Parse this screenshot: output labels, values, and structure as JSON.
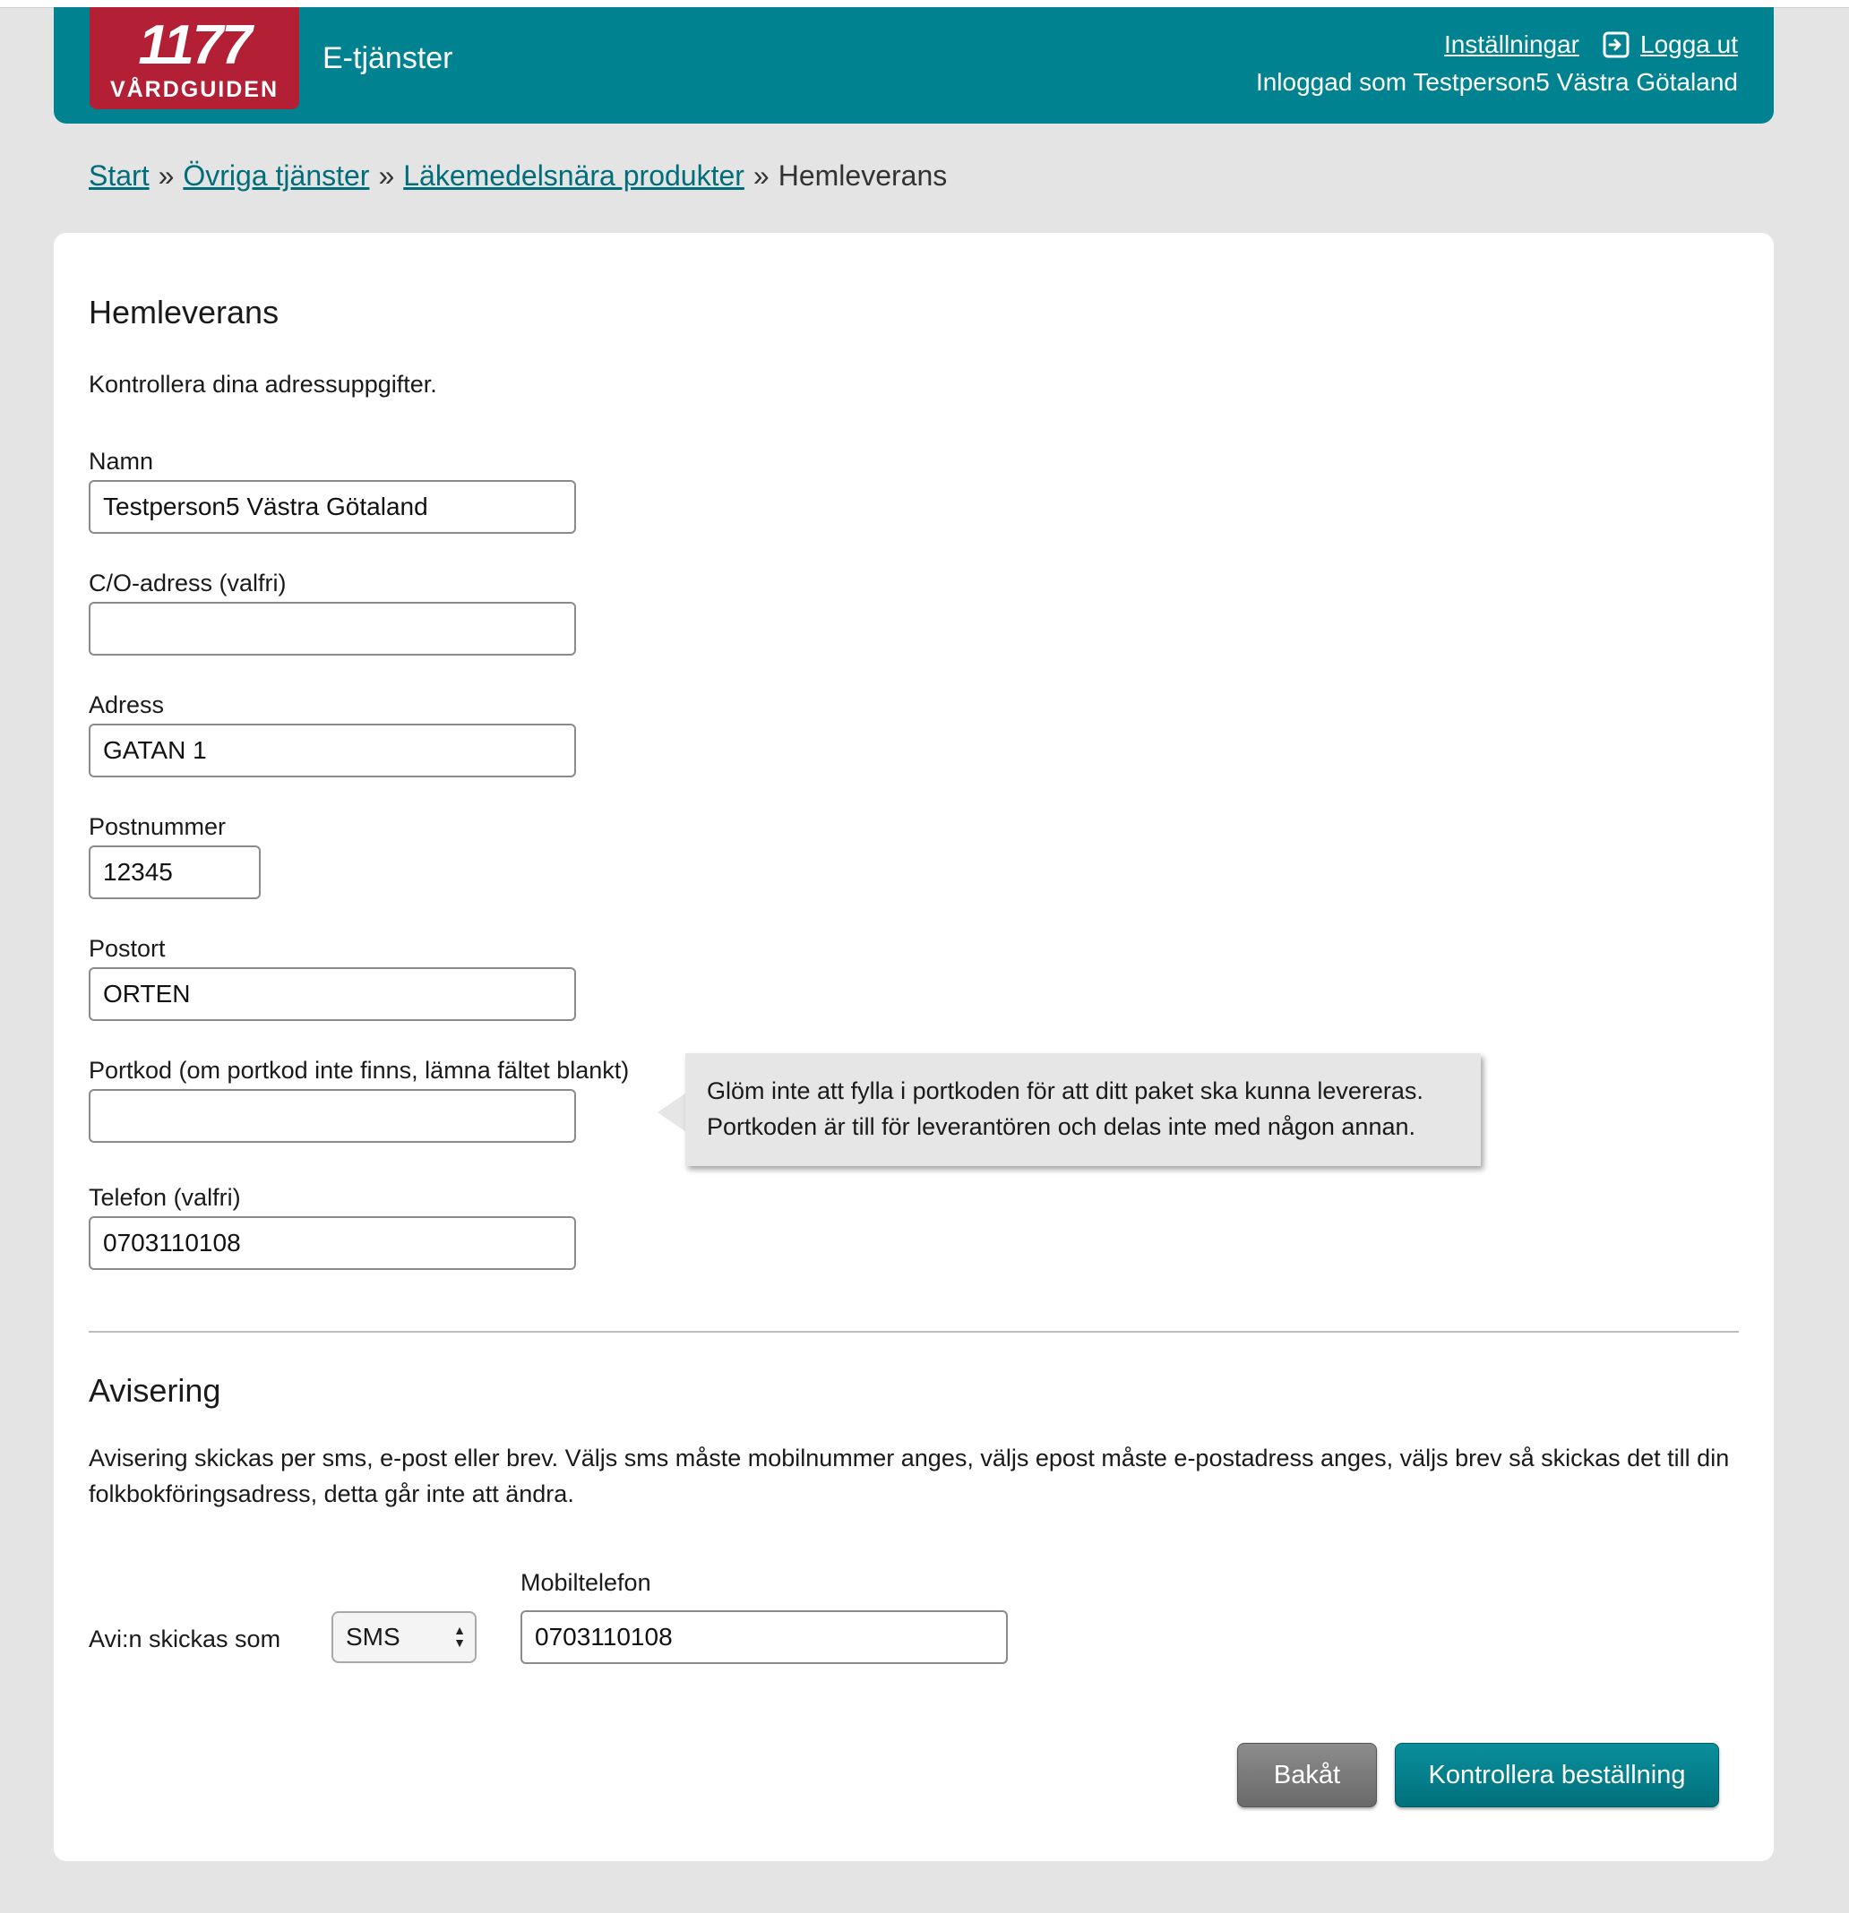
{
  "header": {
    "logo_number": "1177",
    "logo_text": "VÅRDGUIDEN",
    "service_title": "E-tjänster",
    "settings_link": "Inställningar",
    "logout_link": "Logga ut",
    "logged_in_as": "Inloggad som Testperson5 Västra Götaland"
  },
  "breadcrumb": {
    "items": [
      "Start",
      "Övriga tjänster",
      "Läkemedelsnära produkter"
    ],
    "current": "Hemleverans",
    "separator": "»"
  },
  "form": {
    "title": "Hemleverans",
    "intro": "Kontrollera dina adressuppgifter.",
    "fields": {
      "name": {
        "label": "Namn",
        "value": "Testperson5 Västra Götaland"
      },
      "co_address": {
        "label": "C/O-adress (valfri)",
        "value": ""
      },
      "address": {
        "label": "Adress",
        "value": "GATAN 1"
      },
      "postal_code": {
        "label": "Postnummer",
        "value": "12345"
      },
      "city": {
        "label": "Postort",
        "value": "ORTEN"
      },
      "door_code": {
        "label": "Portkod (om portkod inte finns, lämna fältet blankt)",
        "value": ""
      },
      "phone": {
        "label": "Telefon (valfri)",
        "value": "0703110108"
      }
    },
    "door_code_tooltip": {
      "line1": "Glöm inte att fylla i portkoden för att ditt paket ska kunna levereras.",
      "line2": "Portkoden är till för leverantören och delas inte med någon annan."
    }
  },
  "notification": {
    "title": "Avisering",
    "text": "Avisering skickas per sms, e-post eller brev. Väljs sms måste mobilnummer anges, väljs epost måste e-postadress anges, väljs brev så skickas det till din folkbokföringsadress, detta går inte att ändra.",
    "send_as_label": "Avi:n skickas som",
    "send_as_value": "SMS",
    "mobile_label": "Mobiltelefon",
    "mobile_value": "0703110108"
  },
  "buttons": {
    "back": "Bakåt",
    "check_order": "Kontrollera beställning"
  },
  "colors": {
    "header_teal": "#008290",
    "logo_red": "#b31f35",
    "link_teal": "#006d7a",
    "page_background": "#e4e4e4"
  }
}
